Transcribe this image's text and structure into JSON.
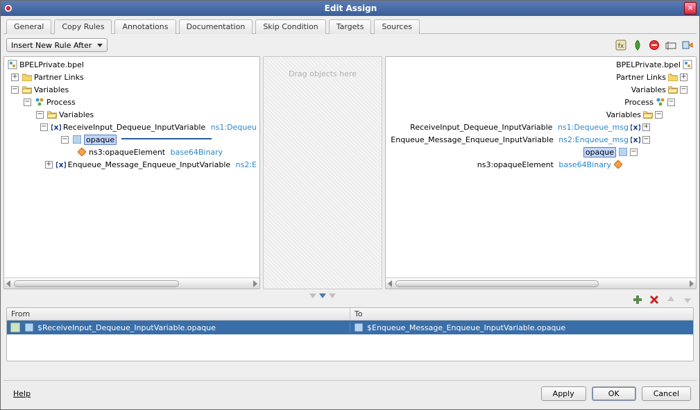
{
  "window": {
    "title": "Edit Assign"
  },
  "tabs": [
    "General",
    "Copy Rules",
    "Annotations",
    "Documentation",
    "Skip Condition",
    "Targets",
    "Sources"
  ],
  "active_tab": 1,
  "toolbar": {
    "insert_rule_label": "Insert New Rule After"
  },
  "drop_hint": "Drag objects here",
  "left_tree": {
    "root": "BPELPrivate.bpel",
    "partner_links": "Partner Links",
    "variables": "Variables",
    "process": "Process",
    "variables2": "Variables",
    "recv": {
      "name": "ReceiveInput_Dequeue_InputVariable",
      "type": "ns1:Dequeu"
    },
    "opaque": "opaque",
    "opaque_elem": {
      "name": "ns3:opaqueElement",
      "type": "base64Binary"
    },
    "enq": {
      "name": "Enqueue_Message_Enqueue_InputVariable",
      "type": "ns2:E"
    }
  },
  "right_tree": {
    "root": "BPELPrivate.bpel",
    "partner_links": "Partner Links",
    "variables": "Variables",
    "process": "Process",
    "variables2": "Variables",
    "recv": {
      "name": "ReceiveInput_Dequeue_InputVariable",
      "type": "ns1:Dequeue_msg"
    },
    "enq": {
      "name": "Enqueue_Message_Enqueue_InputVariable",
      "type": "ns2:Enqueue_msg"
    },
    "opaque": "opaque",
    "opaque_elem": {
      "name": "ns3:opaqueElement",
      "type": "base64Binary"
    }
  },
  "rules": {
    "headers": {
      "from": "From",
      "to": "To"
    },
    "row": {
      "from": "$ReceiveInput_Dequeue_InputVariable.opaque",
      "to": "$Enqueue_Message_Enqueue_InputVariable.opaque"
    }
  },
  "footer": {
    "help": "Help",
    "apply": "Apply",
    "ok": "OK",
    "cancel": "Cancel"
  }
}
